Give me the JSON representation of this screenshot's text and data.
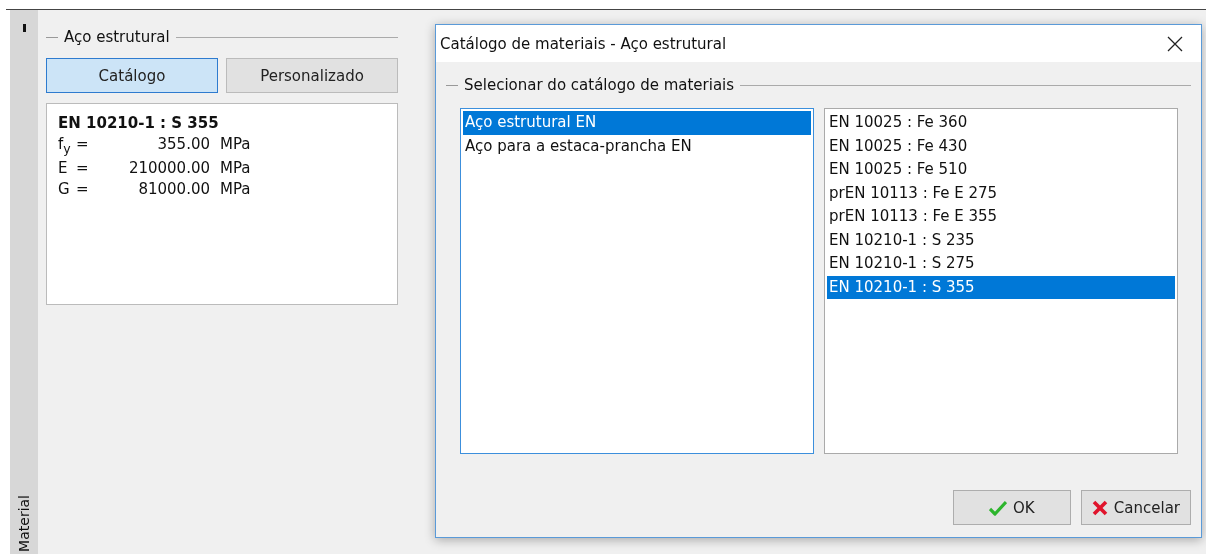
{
  "side_tab": {
    "label": "Material"
  },
  "group": {
    "title": "Aço estrutural"
  },
  "mode_buttons": [
    {
      "label": "Catálogo",
      "selected": true
    },
    {
      "label": "Personalizado",
      "selected": false
    }
  ],
  "material": {
    "name": "EN 10210-1 : S 355",
    "properties": [
      {
        "symbol": "f$_{y}$",
        "eq": "=",
        "value": "355.00",
        "unit": "MPa"
      },
      {
        "symbol": "E",
        "eq": "=",
        "value": "210000.00",
        "unit": "MPa"
      },
      {
        "symbol": "G",
        "eq": "=",
        "value": "81000.00",
        "unit": "MPa"
      }
    ]
  },
  "dialog": {
    "title": "Catálogo de materiais - Aço estrutural",
    "group_title": "Selecionar do catálogo de materiais",
    "catalogs": [
      {
        "label": "Aço estrutural EN",
        "selected": true
      },
      {
        "label": "Aço para a estaca-prancha EN",
        "selected": false
      }
    ],
    "materials": [
      {
        "label": "EN 10025 : Fe 360",
        "selected": false
      },
      {
        "label": "EN 10025 : Fe 430",
        "selected": false
      },
      {
        "label": "EN 10025 : Fe 510",
        "selected": false
      },
      {
        "label": "prEN 10113 : Fe E 275",
        "selected": false
      },
      {
        "label": "prEN 10113 : Fe E 355",
        "selected": false
      },
      {
        "label": "EN 10210-1 : S 235",
        "selected": false
      },
      {
        "label": "EN 10210-1 : S 275",
        "selected": false
      },
      {
        "label": "EN 10210-1 : S 355",
        "selected": true
      }
    ],
    "buttons": [
      {
        "kind": "ok",
        "label": "OK"
      },
      {
        "kind": "cancel",
        "label": "Cancelar"
      }
    ]
  }
}
